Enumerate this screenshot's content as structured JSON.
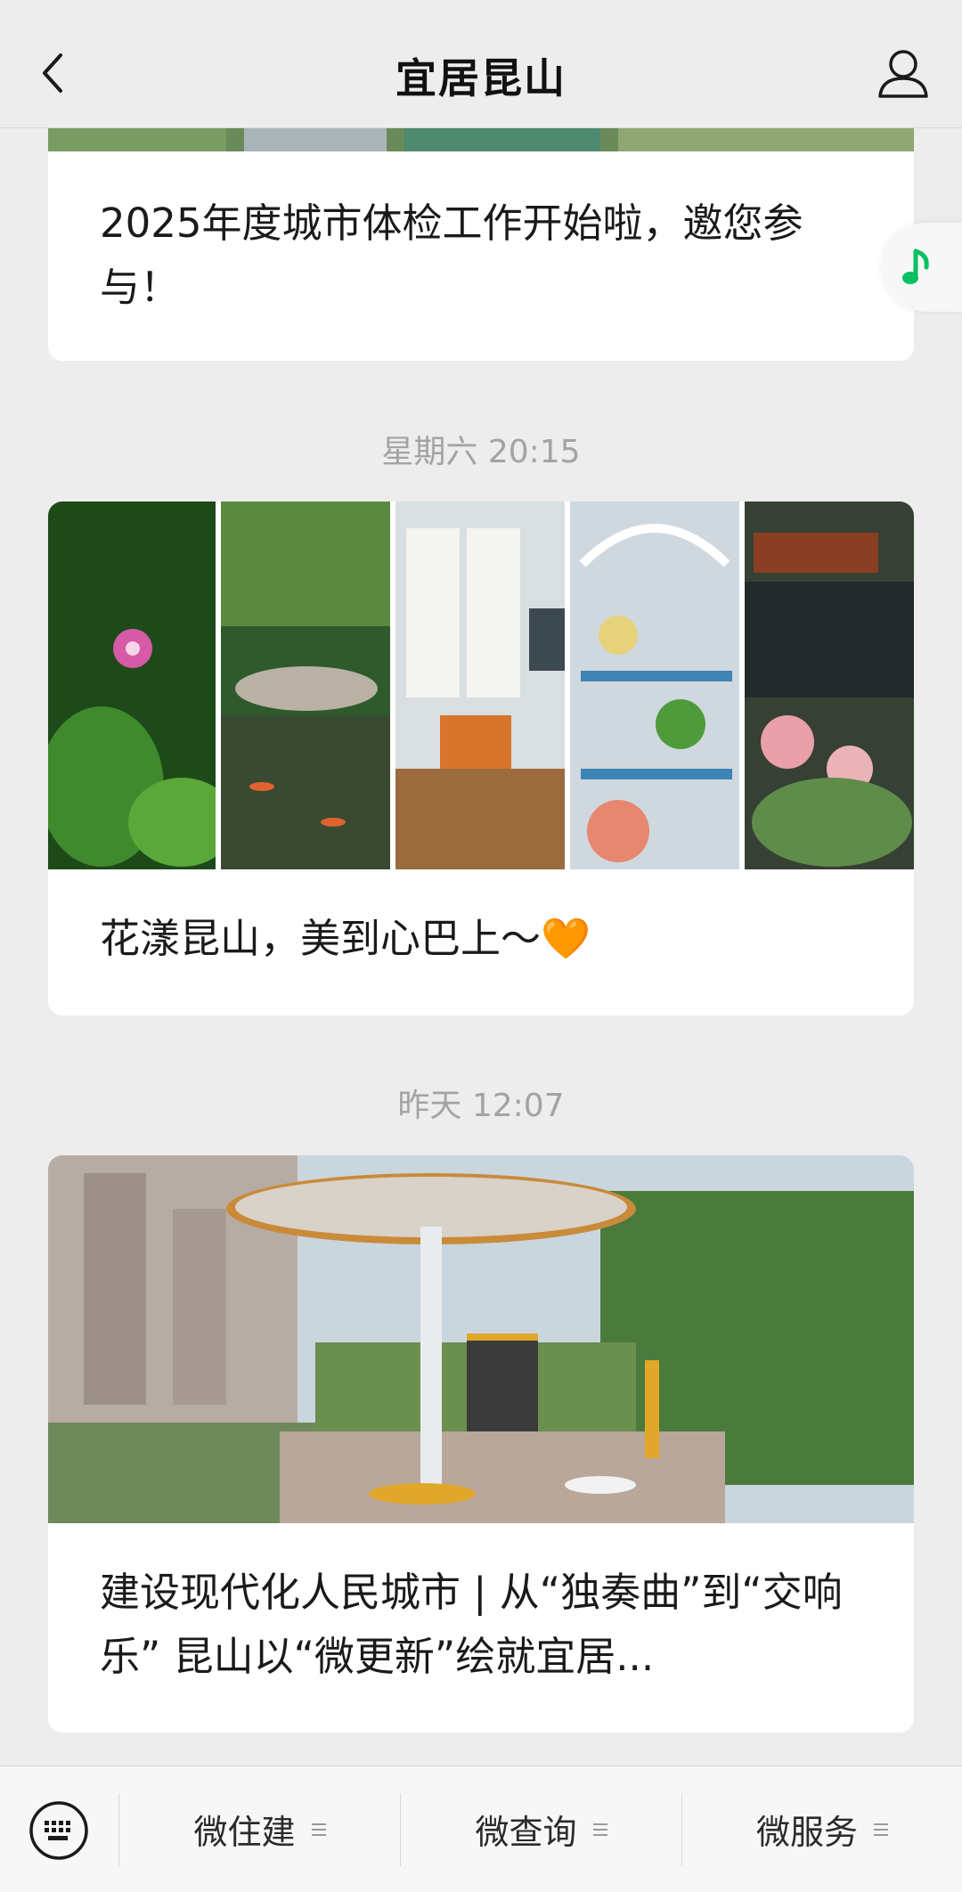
{
  "header": {
    "title": "宜居昆山"
  },
  "feed": {
    "cards": [
      {
        "title": "2025年度城市体检工作开始啦，邀您参与！"
      },
      {
        "timestamp": "星期六 20:15",
        "title": "花漾昆山，美到心巴上～🧡"
      },
      {
        "timestamp": "昨天 12:07",
        "title": "建设现代化人民城市 | 从“独奏曲”到“交响乐” 昆山以“微更新”绘就宜居..."
      }
    ]
  },
  "menu": {
    "items": [
      "微住建",
      "微查询",
      "微服务"
    ]
  },
  "colors": {
    "accent": "#07c160",
    "background": "#ededed"
  }
}
